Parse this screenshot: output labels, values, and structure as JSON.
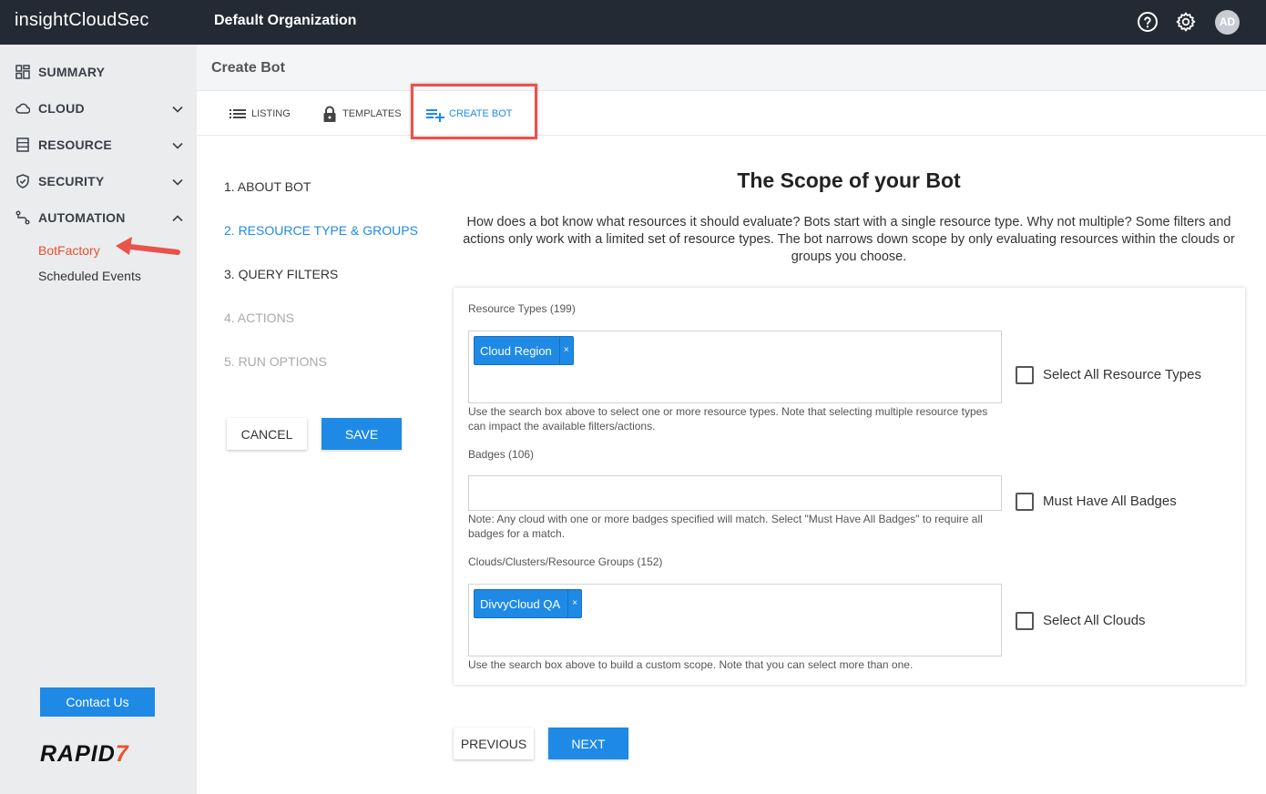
{
  "topbar": {
    "logo_light": "insight",
    "logo_bold": "CloudSec",
    "org_name": "Default Organization",
    "avatar_initials": "AD"
  },
  "sidebar": {
    "items": [
      {
        "label": "SUMMARY",
        "icon": "summary-grid-icon"
      },
      {
        "label": "CLOUD",
        "icon": "cloud-icon"
      },
      {
        "label": "RESOURCE",
        "icon": "resource-icon"
      },
      {
        "label": "SECURITY",
        "icon": "shield-icon"
      },
      {
        "label": "AUTOMATION",
        "icon": "automation-icon"
      }
    ],
    "sub_items": [
      "BotFactory",
      "Scheduled Events"
    ],
    "contact_label": "Contact Us",
    "brand": "RAPID",
    "brand_seven": "7"
  },
  "page": {
    "title": "Create Bot",
    "tabs": [
      {
        "label": "LISTING",
        "icon": "list-icon"
      },
      {
        "label": "TEMPLATES",
        "icon": "lock-icon"
      },
      {
        "label": "CREATE BOT",
        "icon": "add-list-icon"
      }
    ]
  },
  "steps": [
    {
      "label": "1. ABOUT BOT",
      "state": "done"
    },
    {
      "label": "2. RESOURCE TYPE & GROUPS",
      "state": "active"
    },
    {
      "label": "3. QUERY FILTERS",
      "state": "done"
    },
    {
      "label": "4. ACTIONS",
      "state": "disabled"
    },
    {
      "label": "5. RUN OPTIONS",
      "state": "disabled"
    }
  ],
  "buttons": {
    "cancel": "CANCEL",
    "save": "SAVE",
    "previous": "PREVIOUS",
    "next": "NEXT"
  },
  "content": {
    "heading": "The Scope of your Bot",
    "description": "How does a bot know what resources it should evaluate? Bots start with a single resource type. Why not multiple? Some filters and actions only work with a limited set of resource types. The bot narrows down scope by only evaluating resources within the clouds or groups you choose."
  },
  "form": {
    "resource_types": {
      "label": "Resource Types (199)",
      "chip": "Cloud Region",
      "help": "Use the search box above to select one or more resource types. Note that selecting multiple resource types can impact the available filters/actions.",
      "checkbox": "Select All Resource Types",
      "checked": false
    },
    "badges": {
      "label": "Badges (106)",
      "help": "Note: Any cloud with one or more badges specified will match. Select \"Must Have All Badges\" to require all badges for a match.",
      "checkbox": "Must Have All Badges",
      "checked": false
    },
    "clouds": {
      "label": "Clouds/Clusters/Resource Groups (152)",
      "chip": "DivvyCloud QA",
      "help": "Use the search box above to build a custom scope. Note that you can select more than one.",
      "checkbox": "Select All Clouds",
      "checked": false
    }
  },
  "colors": {
    "accent": "#1e8ae6",
    "highlight": "#e8534a",
    "active_sub": "#e8532b",
    "topbar": "#232a33"
  }
}
